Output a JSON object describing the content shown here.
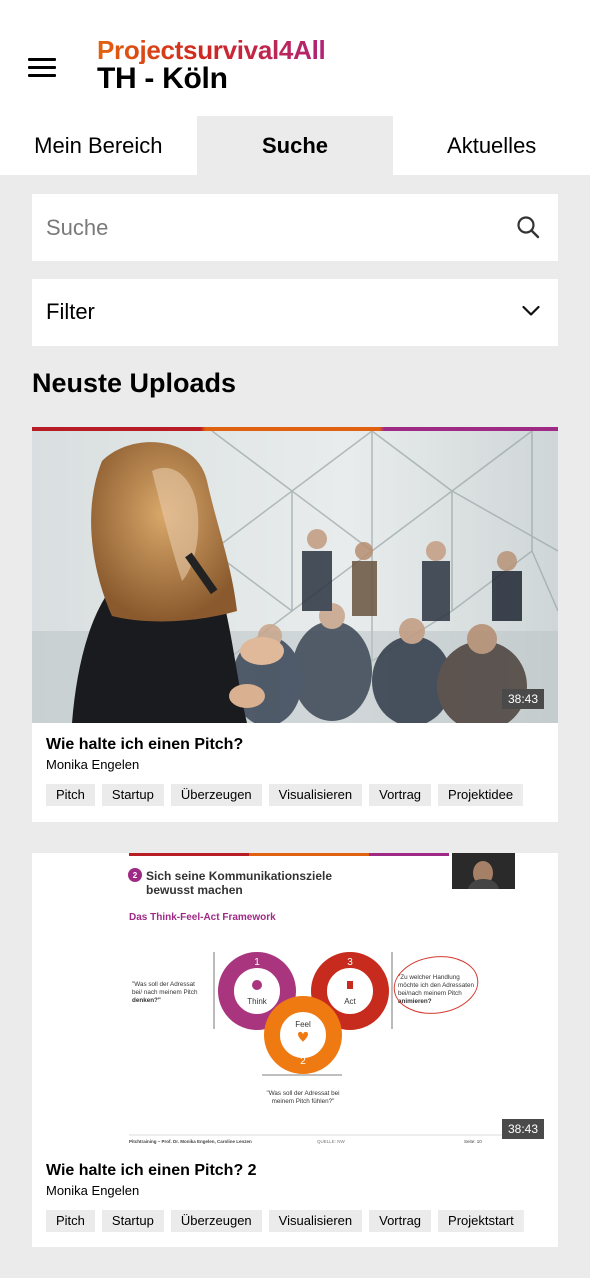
{
  "header": {
    "brand_line1": "Projectsurvival4All",
    "brand_line2": "TH - Köln",
    "menu_icon": "hamburger-menu-icon"
  },
  "tabs": [
    {
      "label": "Mein Bereich",
      "active": false
    },
    {
      "label": "Suche",
      "active": true
    },
    {
      "label": "Aktuelles",
      "active": false
    }
  ],
  "search": {
    "placeholder": "Suche",
    "value": "",
    "icon": "search-icon"
  },
  "filter": {
    "label": "Filter",
    "icon": "chevron-down-icon"
  },
  "section_title": "Neuste Uploads",
  "colors": {
    "brand_orange": "#e2630f",
    "brand_red": "#d0281e",
    "brand_purple": "#b0247a",
    "page_bg": "#ebebeb"
  },
  "videos": [
    {
      "title": "Wie halte ich einen Pitch?",
      "author": "Monika Engelen",
      "duration": "38:43",
      "tags": [
        "Pitch",
        "Startup",
        "Überzeugen",
        "Visualisieren",
        "Vortrag",
        "Projektidee"
      ]
    },
    {
      "title": "Wie halte ich einen Pitch? 2",
      "author": "Monika Engelen",
      "duration": "38:43",
      "tags": [
        "Pitch",
        "Startup",
        "Überzeugen",
        "Visualisieren",
        "Vortrag",
        "Projektstart"
      ],
      "slide": {
        "number": "2",
        "heading_line1": "Sich seine Kommunikationsziele",
        "heading_line2": "bewusst machen",
        "framework": "Das Think-Feel-Act Framework",
        "think_num": "1",
        "think_label": "Think",
        "act_num": "3",
        "act_label": "Act",
        "feel_num": "2",
        "feel_label": "Feel",
        "think_q1": "\"Was soll der Adressat",
        "think_q2": "bei/ nach meinem Pitch",
        "think_q3": "denken?\"",
        "act_q1": "\"Zu welcher Handlung",
        "act_q2": "möchte ich den Adressaten",
        "act_q3": "bei/nach meinem Pitch",
        "act_q4": "animieren?",
        "feel_q1": "\"Was soll der Adressat bei",
        "feel_q2": "meinem Pitch fühlen?\"",
        "footer_left": "Pitchtraining – Prof. Dr. Monika Engelen, Caroline Lenzen",
        "footer_mid": "QUELLE: NW",
        "footer_right": "Seite: 10"
      }
    }
  ]
}
